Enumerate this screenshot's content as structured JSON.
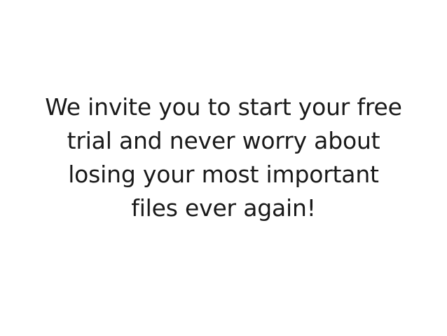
{
  "message": {
    "lines": [
      "We invite you to start your free",
      "trial and never worry about",
      "losing your most important",
      "files ever again!"
    ]
  }
}
